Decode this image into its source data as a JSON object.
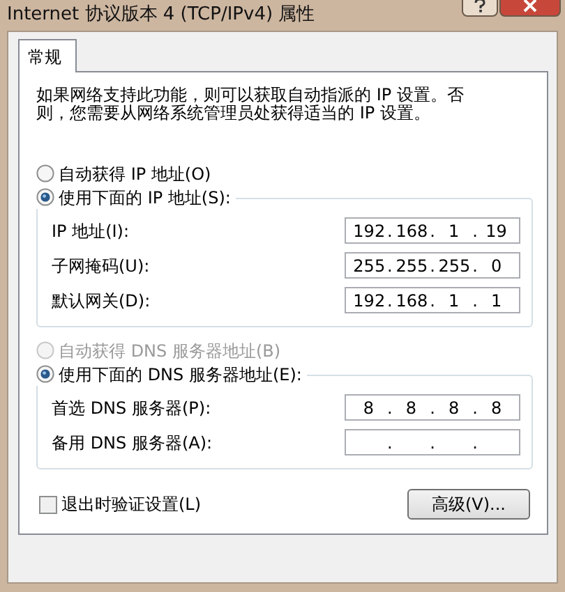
{
  "window": {
    "title": "Internet 协议版本 4 (TCP/IPv4) 属性"
  },
  "tabs": [
    {
      "label": "常规",
      "selected": true
    }
  ],
  "description": "如果网络支持此功能，则可以获取自动指派的 IP 设置。否则，您需要从网络系统管理员处获得适当的 IP 设置。",
  "separator": ".",
  "sections": [
    {
      "options": [
        {
          "label": "自动获得 IP 地址(O)",
          "selected": false,
          "disabled": false
        },
        {
          "label": "使用下面的 IP 地址(S):",
          "selected": true,
          "disabled": false
        }
      ],
      "fields": [
        {
          "label": "IP 地址(I):",
          "octets": [
            "192",
            "168",
            "1",
            "19"
          ]
        },
        {
          "label": "子网掩码(U):",
          "octets": [
            "255",
            "255",
            "255",
            "0"
          ]
        },
        {
          "label": "默认网关(D):",
          "octets": [
            "192",
            "168",
            "1",
            "1"
          ]
        }
      ]
    },
    {
      "options": [
        {
          "label": "自动获得 DNS 服务器地址(B)",
          "selected": false,
          "disabled": true
        },
        {
          "label": "使用下面的 DNS 服务器地址(E):",
          "selected": true,
          "disabled": false
        }
      ],
      "fields": [
        {
          "label": "首选 DNS 服务器(P):",
          "octets": [
            "8",
            "8",
            "8",
            "8"
          ]
        },
        {
          "label": "备用 DNS 服务器(A):"
        }
      ]
    }
  ],
  "validate_checkbox": {
    "label": "退出时验证设置(L)",
    "checked": false
  },
  "advanced_button": {
    "label": "高级(V)..."
  }
}
